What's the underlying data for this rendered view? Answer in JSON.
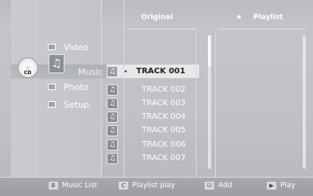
{
  "headers": {
    "original": "Original",
    "playlist_star": "★",
    "playlist": "Playlist"
  },
  "menu": {
    "items": [
      {
        "label": "Video",
        "icon": "video-icon"
      },
      {
        "label": "Music",
        "icon": "music-icon",
        "selected": true
      },
      {
        "label": "Photo",
        "icon": "photo-icon"
      },
      {
        "label": "Setup",
        "icon": "setup-icon"
      }
    ]
  },
  "disc": {
    "label": "CD"
  },
  "tracks": {
    "selected_marker": "◂",
    "items": [
      {
        "label": "TRACK 001",
        "selected": true
      },
      {
        "label": "TRACK 002"
      },
      {
        "label": "TRACK 003"
      },
      {
        "label": "TRACK 004"
      },
      {
        "label": "TRACK 005"
      },
      {
        "label": "TRACK 006"
      },
      {
        "label": "TRACK 007"
      }
    ]
  },
  "bottom": {
    "music_list": {
      "key": "B",
      "label": "Music List"
    },
    "playlist_play": {
      "key": "C",
      "label": "Playlist play"
    },
    "add": {
      "key": "☑",
      "label": "Add"
    },
    "play": {
      "key": "▶",
      "label": "Play"
    }
  },
  "colors": {
    "background": "#c4c6ca",
    "selection": "#e7e8ea",
    "bottom_bar": "#a3a5a9"
  }
}
